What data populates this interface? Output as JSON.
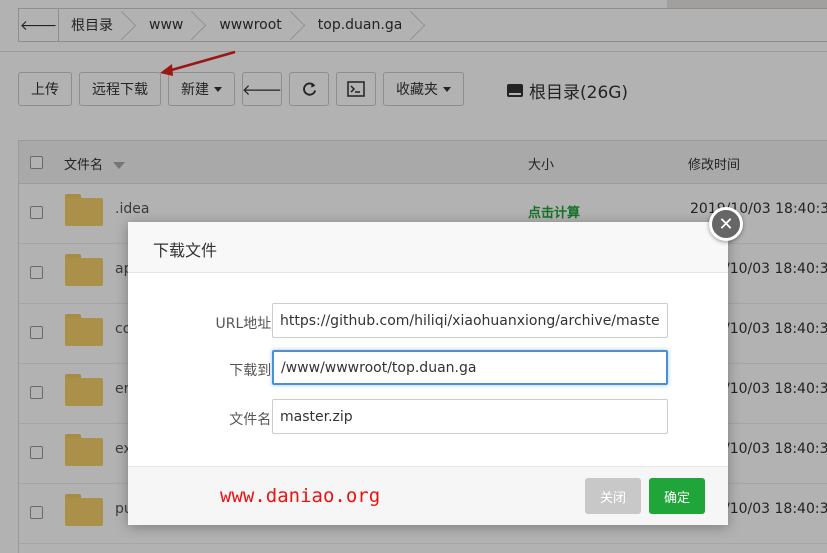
{
  "breadcrumb": {
    "back_icon": "arrow-left-icon",
    "items": [
      "根目录",
      "www",
      "wwwroot",
      "top.duan.ga"
    ]
  },
  "toolbar": {
    "upload": "上传",
    "remote_download": "远程下载",
    "new": "新建",
    "back_icon": "arrow-left-icon",
    "refresh_icon": "refresh-icon",
    "terminal_icon": "terminal-icon",
    "favorites": "收藏夹",
    "disk_label": "根目录(26G)"
  },
  "table": {
    "headers": {
      "name": "文件名",
      "size": "大小",
      "modified": "修改时间"
    },
    "rows": [
      {
        "name": ".idea",
        "size": "点击计算",
        "time": "2019/10/03 18:40:3"
      },
      {
        "name": "ap",
        "size": "",
        "time": "/10/03 18:40:3"
      },
      {
        "name": "co",
        "size": "",
        "time": "/10/03 18:40:3"
      },
      {
        "name": "er",
        "size": "",
        "time": "/10/03 18:40:3"
      },
      {
        "name": "ex",
        "size": "",
        "time": "/10/03 18:40:3"
      },
      {
        "name": "pu",
        "size": "",
        "time": "/10/03 18:40:3"
      }
    ]
  },
  "dialog": {
    "title": "下载文件",
    "close_icon": "close-icon",
    "url_label": "URL地址:",
    "url_value": "https://github.com/hiliqi/xiaohuanxiong/archive/master.",
    "dest_label": "下载到:",
    "dest_value": "/www/wwwroot/top.duan.ga",
    "filename_label": "文件名:",
    "filename_value": "master.zip",
    "watermark": "www.daniao.org",
    "cancel_label": "关闭",
    "ok_label": "确定"
  },
  "colors": {
    "accent_green": "#20a53a",
    "watermark_red": "#ee1111",
    "focus_blue": "#4a90d9"
  }
}
